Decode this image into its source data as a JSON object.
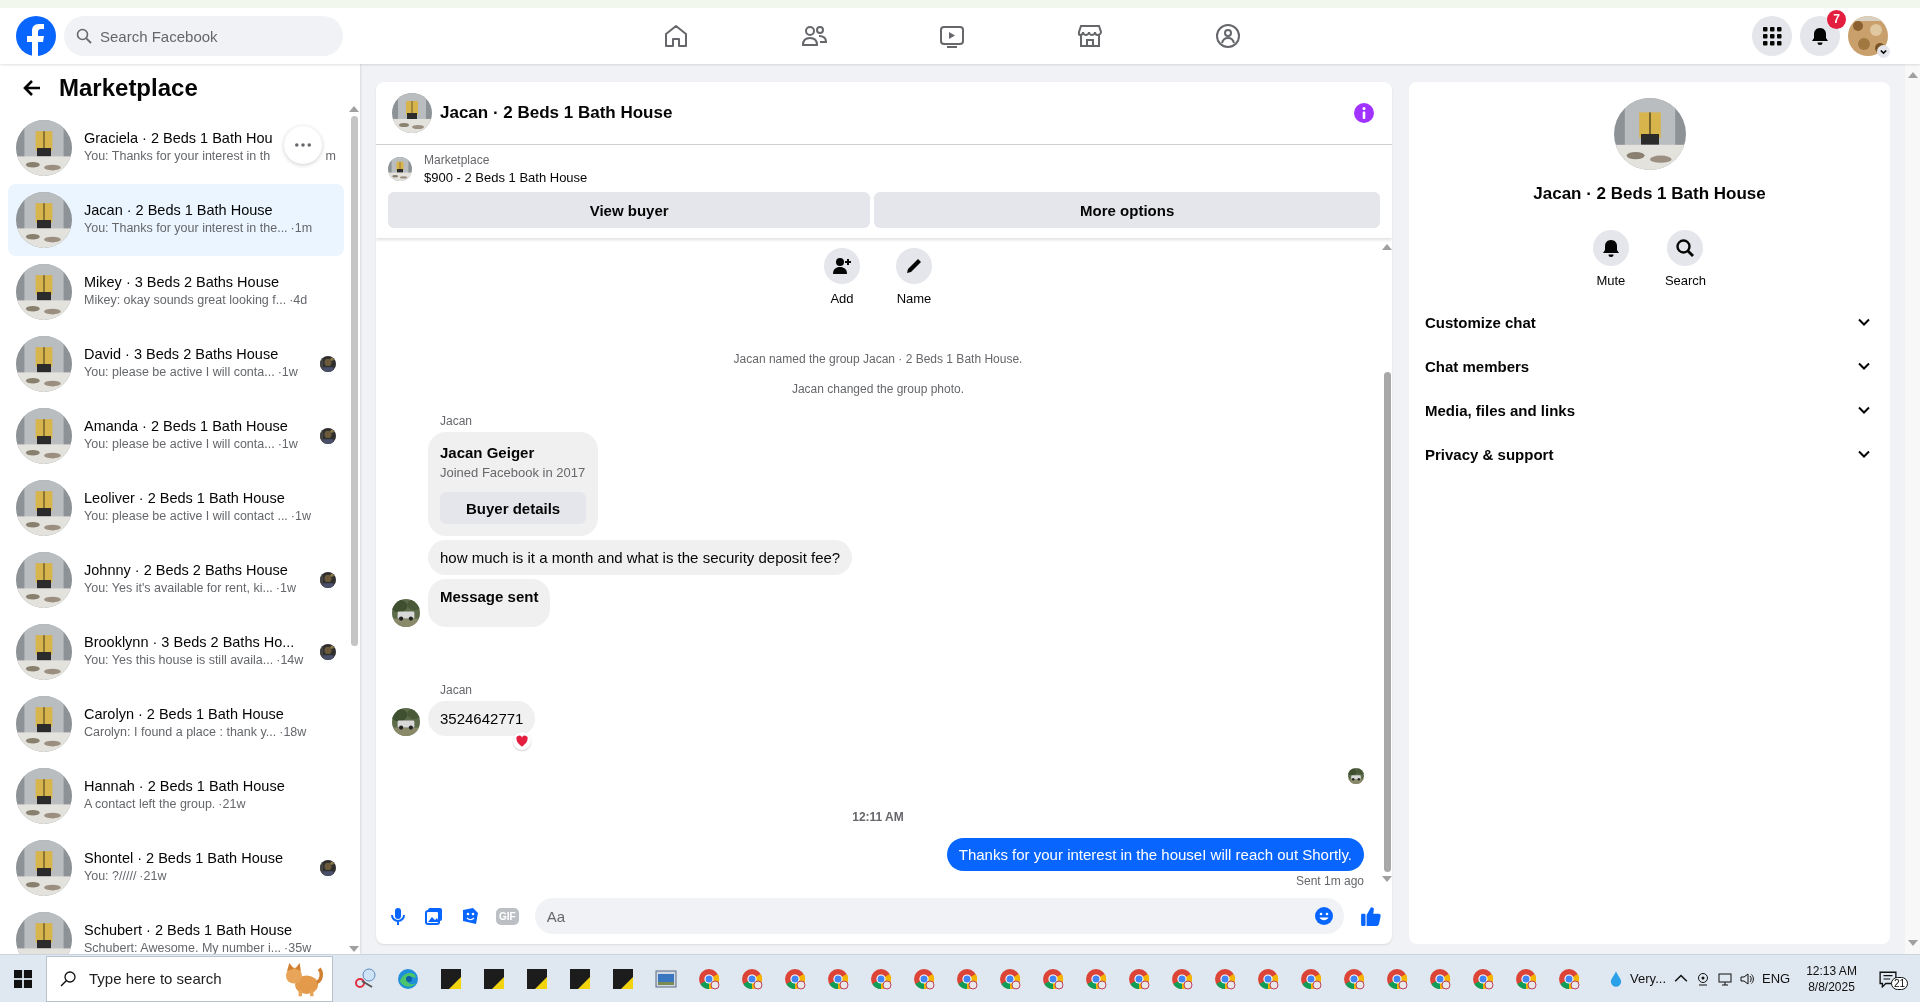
{
  "header": {
    "search_placeholder": "Search Facebook",
    "notification_count": "7"
  },
  "sidebar": {
    "title": "Marketplace",
    "conversations": [
      {
        "title": "Graciela · 2 Beds 1 Bath Hou",
        "preview": "You: Thanks for your interest in th",
        "time": "m",
        "selected": false,
        "seen": false,
        "more_button": true
      },
      {
        "title": "Jacan · 2 Beds 1 Bath House",
        "preview": "You: Thanks for your interest in the...",
        "time": "·1m",
        "selected": true,
        "seen": false,
        "more_button": false
      },
      {
        "title": "Mikey · 3 Beds 2 Baths House",
        "preview": "Mikey: okay sounds great looking f...",
        "time": "·4d",
        "selected": false,
        "seen": false,
        "more_button": false
      },
      {
        "title": "David · 3 Beds 2 Baths House",
        "preview": "You: please be active I will conta...",
        "time": "·1w",
        "selected": false,
        "seen": true,
        "more_button": false
      },
      {
        "title": "Amanda · 2 Beds 1 Bath House",
        "preview": "You: please be active I will conta...",
        "time": "·1w",
        "selected": false,
        "seen": true,
        "more_button": false
      },
      {
        "title": "Leoliver · 2 Beds 1 Bath House",
        "preview": "You: please be active I will contact ...",
        "time": "·1w",
        "selected": false,
        "seen": false,
        "more_button": false
      },
      {
        "title": "Johnny · 2 Beds 2 Baths House",
        "preview": "You: Yes it's available for rent, ki...",
        "time": "·1w",
        "selected": false,
        "seen": true,
        "more_button": false
      },
      {
        "title": "Brooklynn · 3 Beds 2 Baths Ho...",
        "preview": "You: Yes this house is still availa...",
        "time": "·14w",
        "selected": false,
        "seen": true,
        "more_button": false
      },
      {
        "title": "Carolyn · 2 Beds 1 Bath House",
        "preview": "Carolyn: I found a place : thank y...",
        "time": "·18w",
        "selected": false,
        "seen": false,
        "more_button": false
      },
      {
        "title": "Hannah · 2 Beds 1 Bath House",
        "preview": "A contact left the group.",
        "time": "·21w",
        "selected": false,
        "seen": false,
        "more_button": false
      },
      {
        "title": "Shontel · 2 Beds 1 Bath House",
        "preview": "You: ?/////",
        "time": "·21w",
        "selected": false,
        "seen": true,
        "more_button": false
      },
      {
        "title": "Schubert · 2 Beds 1 Bath House",
        "preview": "Schubert: Awesome. My number i...",
        "time": "·35w",
        "selected": false,
        "seen": false,
        "more_button": false
      }
    ]
  },
  "chat": {
    "title": "Jacan · 2 Beds 1 Bath House",
    "listing": {
      "source": "Marketplace",
      "title": "$900 - 2 Beds 1 Bath House",
      "buttons": [
        "View buyer",
        "More options"
      ]
    },
    "actions": [
      {
        "kind": "add",
        "label": "Add"
      },
      {
        "kind": "name",
        "label": "Name"
      }
    ],
    "events": [
      {
        "kind": "system",
        "text": "Jacan named the group Jacan · 2 Beds 1 Bath House."
      },
      {
        "kind": "system",
        "text": "Jacan changed the group photo."
      },
      {
        "kind": "incoming",
        "sender": "Jacan",
        "card": {
          "name": "Jacan Geiger",
          "detail": "Joined Facebook in 2017",
          "button": "Buyer details"
        },
        "messages": [
          {
            "text": "how much is it a month and what is the security deposit fee?",
            "bold": false,
            "reaction": false
          },
          {
            "text": "Message sent",
            "bold": true,
            "reaction": false
          }
        ]
      },
      {
        "kind": "incoming",
        "sender": "Jacan",
        "messages": [
          {
            "text": "3524642771",
            "bold": false,
            "reaction": true
          }
        ]
      },
      {
        "kind": "seen"
      },
      {
        "kind": "timestamp",
        "text": "12:11 AM"
      },
      {
        "kind": "outgoing",
        "text": "Thanks for your interest in the houseI will reach out Shortly.",
        "status": "Sent 1m ago"
      }
    ],
    "composer": {
      "gif": "GIF",
      "placeholder": "Aa"
    }
  },
  "details": {
    "title": "Jacan · 2 Beds 1 Bath House",
    "actions": [
      {
        "kind": "mute",
        "label": "Mute"
      },
      {
        "kind": "search",
        "label": "Search"
      }
    ],
    "sections": [
      {
        "label": "Customize chat",
        "expanded": false
      },
      {
        "label": "Chat members",
        "expanded": false
      },
      {
        "label": "Media, files and links",
        "expanded": false
      },
      {
        "label": "Privacy & support",
        "expanded": false
      }
    ]
  },
  "taskbar": {
    "search_placeholder": "Type here to search",
    "apps": [
      {
        "kind": "snip"
      },
      {
        "kind": "edge"
      },
      {
        "kind": "sticky"
      },
      {
        "kind": "sticky"
      },
      {
        "kind": "sticky"
      },
      {
        "kind": "sticky"
      },
      {
        "kind": "sticky"
      },
      {
        "kind": "photos"
      },
      {
        "kind": "chrome"
      },
      {
        "kind": "chrome"
      },
      {
        "kind": "chrome"
      },
      {
        "kind": "chrome"
      },
      {
        "kind": "chrome"
      },
      {
        "kind": "chrome"
      },
      {
        "kind": "chrome"
      },
      {
        "kind": "chrome"
      },
      {
        "kind": "chrome"
      },
      {
        "kind": "chrome"
      },
      {
        "kind": "chrome"
      },
      {
        "kind": "chrome"
      },
      {
        "kind": "chrome"
      },
      {
        "kind": "chrome"
      },
      {
        "kind": "chrome"
      },
      {
        "kind": "chrome"
      },
      {
        "kind": "chrome"
      },
      {
        "kind": "chrome"
      },
      {
        "kind": "chrome"
      },
      {
        "kind": "chrome"
      },
      {
        "kind": "chrome"
      }
    ],
    "weather": "Very...",
    "language": "ENG",
    "time": "12:13 AM",
    "date": "8/8/2025",
    "notifications": "21"
  }
}
